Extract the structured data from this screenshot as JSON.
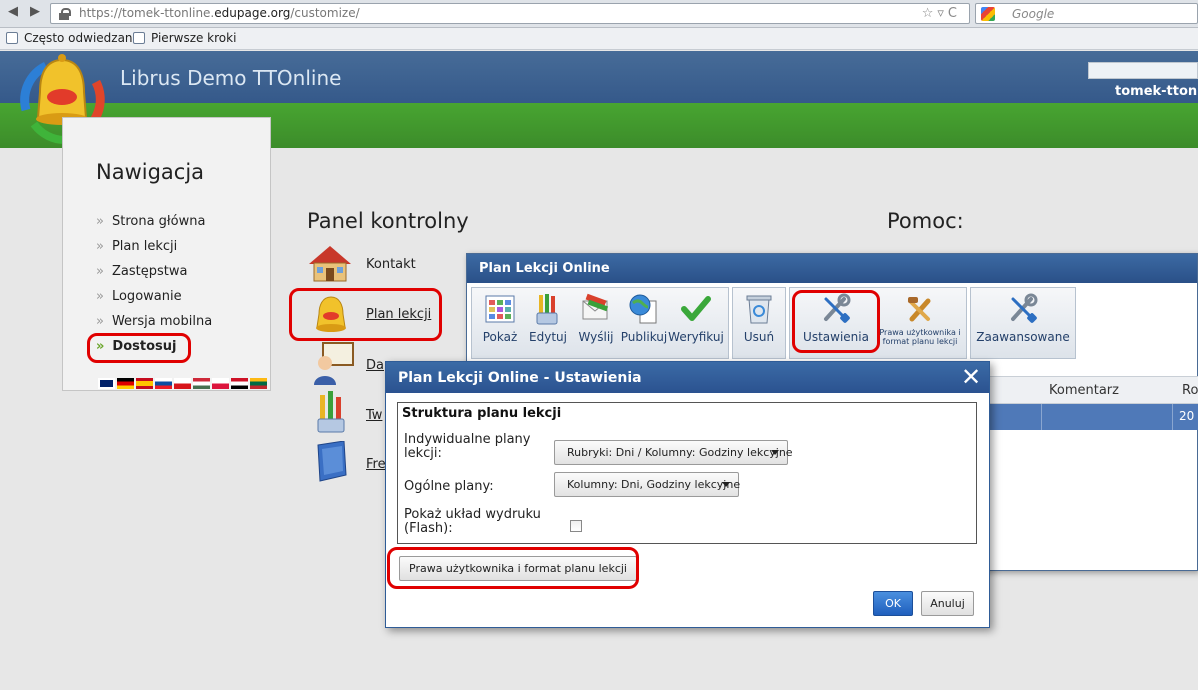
{
  "browser": {
    "url_prefix": "https://tomek-ttonline.",
    "url_domain": "edupage.org",
    "url_path": "/customize/",
    "search_placeholder": "Google",
    "bookmarks": [
      "Często odwiedzane",
      "Pierwsze kroki"
    ]
  },
  "header": {
    "site_title": "Librus Demo TTOnline",
    "username": "tomek-ttonli"
  },
  "nav": {
    "title": "Nawigacja",
    "items": [
      {
        "label": "Strona główna"
      },
      {
        "label": "Plan lekcji"
      },
      {
        "label": "Zastępstwa"
      },
      {
        "label": "Logowanie"
      },
      {
        "label": "Wersja mobilna"
      },
      {
        "label": "Dostosuj"
      }
    ],
    "flags": [
      "gb",
      "de",
      "es",
      "sk",
      "cz",
      "hu",
      "pl",
      "eg",
      "lt"
    ]
  },
  "control_panel": {
    "title": "Panel kontrolny",
    "items": [
      {
        "label": "Kontakt",
        "icon": "house-icon"
      },
      {
        "label": "Plan lekcji",
        "icon": "bell-icon"
      },
      {
        "label": "Da",
        "icon": "teacher-icon"
      },
      {
        "label": "Tw",
        "icon": "pencils-icon"
      },
      {
        "label": "Fre",
        "icon": "book-icon"
      }
    ]
  },
  "help": {
    "title": "Pomoc:"
  },
  "main_window": {
    "title": "Plan Lekcji Online",
    "toolbar_group1": [
      {
        "label": "Pokaż",
        "icon": "schedule-grid-icon"
      },
      {
        "label": "Edytuj",
        "icon": "pencils-icon"
      },
      {
        "label": "Wyślij",
        "icon": "send-mail-icon"
      },
      {
        "label": "Publikuj",
        "icon": "globe-document-icon"
      },
      {
        "label": "Weryfikuj",
        "icon": "checkmark-icon"
      }
    ],
    "toolbar_group2": [
      {
        "label": "Usuń",
        "icon": "recycle-bin-icon"
      }
    ],
    "toolbar_group3": [
      {
        "label": "Ustawienia",
        "icon": "wrench-screwdriver-icon"
      },
      {
        "label": "Prawa użytkownika i format planu lekcji",
        "icon": "tools-icon"
      }
    ],
    "toolbar_group4": [
      {
        "label": "Zaawansowane",
        "icon": "wrench-screwdriver-icon"
      }
    ],
    "grid_headers": [
      "Komentarz",
      "Ro"
    ],
    "grid_row_value": "20"
  },
  "dialog": {
    "title": "Plan Lekcji Online - Ustawienia",
    "legend": "Struktura planu lekcji",
    "field1_label": "Indywidualne plany lekcji:",
    "field1_value": "Rubryki: Dni / Kolumny: Godziny lekcyjne",
    "field2_label": "Ogólne plany:",
    "field2_value": "Kolumny: Dni, Godziny lekcyjne",
    "field3_label": "Pokaż układ wydruku (Flash):",
    "field3_checked": false,
    "rights_button": "Prawa użytkownika i format planu lekcji",
    "ok": "OK",
    "cancel": "Anuluj"
  },
  "colors": {
    "header_blue": "#3f6594",
    "header_green": "#44a02f",
    "highlight_red": "#e00000",
    "dialog_blue": "#2f5c97"
  }
}
